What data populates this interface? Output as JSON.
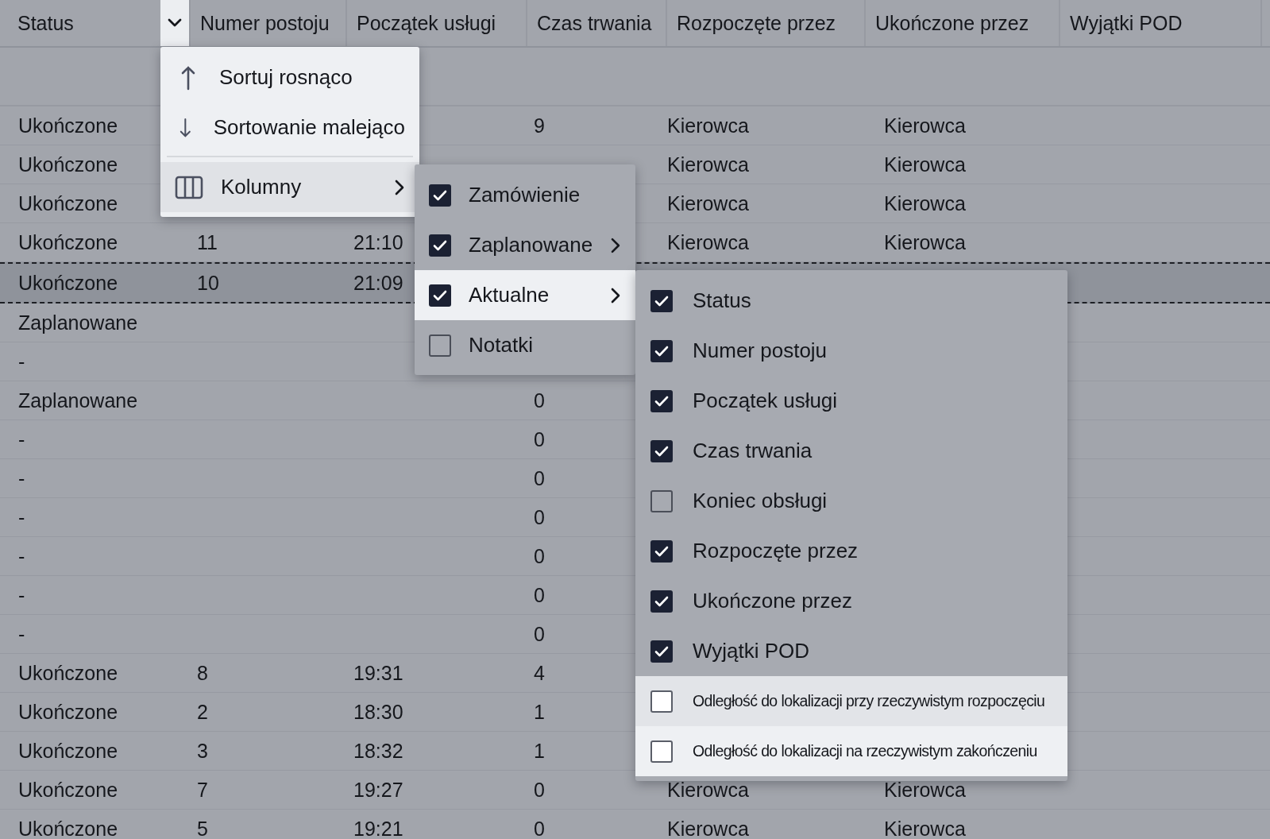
{
  "table": {
    "columns": [
      {
        "label": "Status",
        "has_menu": true
      },
      {
        "label": "Numer postoju",
        "has_menu": false
      },
      {
        "label": "Początek usługi",
        "has_menu": false
      },
      {
        "label": "Czas trwania",
        "has_menu": false
      },
      {
        "label": "Rozpoczęte przez",
        "has_menu": false
      },
      {
        "label": "Ukończone przez",
        "has_menu": false
      },
      {
        "label": "Wyjątki POD",
        "has_menu": false
      }
    ],
    "rows": [
      {
        "selected": false,
        "cells": [
          "Ukończone",
          null,
          null,
          "9",
          "Kierowca",
          "Kierowca",
          null
        ]
      },
      {
        "selected": false,
        "cells": [
          "Ukończone",
          null,
          null,
          null,
          "Kierowca",
          "Kierowca",
          null
        ]
      },
      {
        "selected": false,
        "cells": [
          "Ukończone",
          null,
          null,
          null,
          "Kierowca",
          "Kierowca",
          null
        ]
      },
      {
        "selected": false,
        "cells": [
          "Ukończone",
          "11",
          "21:10",
          null,
          "Kierowca",
          "Kierowca",
          null
        ]
      },
      {
        "selected": true,
        "cells": [
          "Ukończone",
          "10",
          "21:09",
          null,
          null,
          null,
          null
        ]
      },
      {
        "selected": false,
        "cells": [
          "Zaplanowane",
          null,
          null,
          null,
          null,
          null,
          null
        ]
      },
      {
        "selected": false,
        "cells": [
          "-",
          null,
          null,
          null,
          null,
          null,
          null
        ]
      },
      {
        "selected": false,
        "cells": [
          "Zaplanowane",
          null,
          null,
          "0",
          null,
          null,
          null
        ]
      },
      {
        "selected": false,
        "cells": [
          "-",
          null,
          null,
          "0",
          null,
          null,
          null
        ]
      },
      {
        "selected": false,
        "cells": [
          "-",
          null,
          null,
          "0",
          null,
          null,
          null
        ]
      },
      {
        "selected": false,
        "cells": [
          "-",
          null,
          null,
          "0",
          null,
          null,
          null
        ]
      },
      {
        "selected": false,
        "cells": [
          "-",
          null,
          null,
          "0",
          null,
          null,
          null
        ]
      },
      {
        "selected": false,
        "cells": [
          "-",
          null,
          null,
          "0",
          null,
          null,
          null
        ]
      },
      {
        "selected": false,
        "cells": [
          "-",
          null,
          null,
          "0",
          null,
          null,
          null
        ]
      },
      {
        "selected": false,
        "cells": [
          "Ukończone",
          "8",
          "19:31",
          "4",
          null,
          null,
          null
        ]
      },
      {
        "selected": false,
        "cells": [
          "Ukończone",
          "2",
          "18:30",
          "1",
          null,
          null,
          null
        ]
      },
      {
        "selected": false,
        "cells": [
          "Ukończone",
          "3",
          "18:32",
          "1",
          null,
          null,
          null
        ]
      },
      {
        "selected": false,
        "cells": [
          "Ukończone",
          "7",
          "19:27",
          "0",
          "Kierowca",
          "Kierowca",
          null
        ]
      },
      {
        "selected": false,
        "cells": [
          "Ukończone",
          "5",
          "19:21",
          "0",
          "Kierowca",
          "Kierowca",
          null
        ]
      }
    ]
  },
  "column_menu": {
    "items": [
      {
        "kind": "sort_ascending",
        "label": "Sortuj rosnąco",
        "hovered": false
      },
      {
        "kind": "sort_descending",
        "label": "Sortowanie malejąco",
        "hovered": false
      },
      {
        "kind": "columns",
        "label": "Kolumny",
        "hovered": true
      }
    ]
  },
  "columns_menu": {
    "items": [
      {
        "label": "Zamówienie",
        "checked": true,
        "has_submenu": false,
        "lit": false,
        "hovered": false
      },
      {
        "label": "Zaplanowane",
        "checked": true,
        "has_submenu": true,
        "lit": false,
        "hovered": false
      },
      {
        "label": "Aktualne",
        "checked": true,
        "has_submenu": true,
        "lit": true,
        "hovered": false
      },
      {
        "label": "Notatki",
        "checked": false,
        "has_submenu": false,
        "lit": false,
        "hovered": false
      }
    ]
  },
  "actual_columns_menu": {
    "items": [
      {
        "label": "Status",
        "checked": true,
        "has_submenu": false,
        "lit": false,
        "hovered": false
      },
      {
        "label": "Numer postoju",
        "checked": true,
        "has_submenu": false,
        "lit": false,
        "hovered": false
      },
      {
        "label": "Początek usługi",
        "checked": true,
        "has_submenu": false,
        "lit": false,
        "hovered": false
      },
      {
        "label": "Czas trwania",
        "checked": true,
        "has_submenu": false,
        "lit": false,
        "hovered": false
      },
      {
        "label": "Koniec obsługi",
        "checked": false,
        "has_submenu": false,
        "lit": false,
        "hovered": false
      },
      {
        "label": "Rozpoczęte przez",
        "checked": true,
        "has_submenu": false,
        "lit": false,
        "hovered": false
      },
      {
        "label": "Ukończone przez",
        "checked": true,
        "has_submenu": false,
        "lit": false,
        "hovered": false
      },
      {
        "label": "Wyjątki POD",
        "checked": true,
        "has_submenu": false,
        "lit": false,
        "hovered": false
      },
      {
        "label": "Odległość do lokalizacji przy rzeczywistym rozpoczęciu",
        "checked": false,
        "has_submenu": false,
        "lit": true,
        "hovered": true
      },
      {
        "label": "Odległość do lokalizacji na rzeczywistym zakończeniu",
        "checked": false,
        "has_submenu": false,
        "lit": true,
        "hovered": false
      }
    ]
  }
}
